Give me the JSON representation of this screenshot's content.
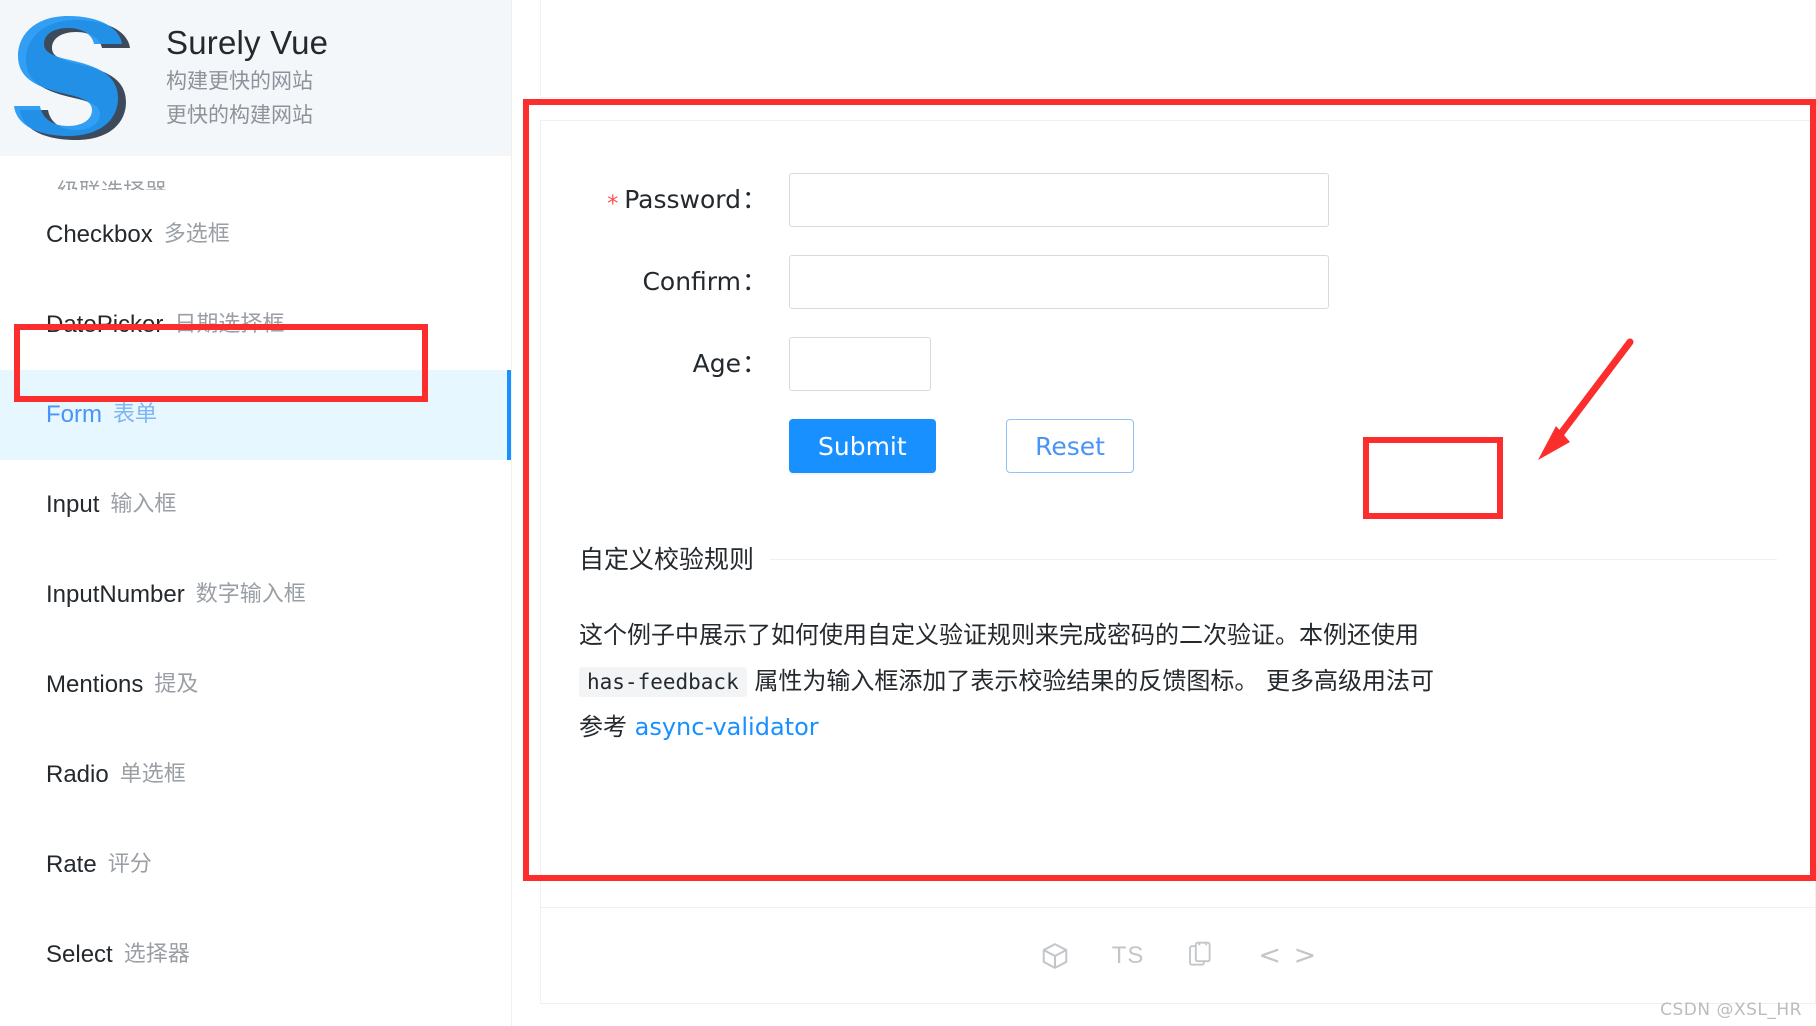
{
  "brand": {
    "title": "Surely Vue",
    "subtitle_line1": "构建更快的网站",
    "subtitle_line2": "更快的构建网站",
    "logo_letter": "S",
    "logo_colors": {
      "blue": "#1890ff",
      "dark": "#3c4a5c"
    },
    "background": "#f4f7fa"
  },
  "sidebar": {
    "items": [
      {
        "en": "",
        "cn": "级联选择器",
        "active": false,
        "clipped": true
      },
      {
        "en": "Checkbox",
        "cn": "多选框",
        "active": false
      },
      {
        "en": "DatePicker",
        "cn": "日期选择框",
        "active": false
      },
      {
        "en": "Form",
        "cn": "表单",
        "active": true
      },
      {
        "en": "Input",
        "cn": "输入框",
        "active": false
      },
      {
        "en": "InputNumber",
        "cn": "数字输入框",
        "active": false
      },
      {
        "en": "Mentions",
        "cn": "提及",
        "active": false
      },
      {
        "en": "Radio",
        "cn": "单选框",
        "active": false
      },
      {
        "en": "Rate",
        "cn": "评分",
        "active": false
      },
      {
        "en": "Select",
        "cn": "选择器",
        "active": false
      }
    ]
  },
  "toolbar": {
    "icons": [
      {
        "name": "codesandbox-icon",
        "label": ""
      },
      {
        "name": "typescript-icon",
        "label": "TS"
      },
      {
        "name": "copy-icon",
        "label": ""
      },
      {
        "name": "code-brackets-icon",
        "label": "< >"
      }
    ]
  },
  "form": {
    "fields": [
      {
        "label": "Password",
        "required": true,
        "value": "",
        "placeholder": "",
        "width": "wide"
      },
      {
        "label": "Confirm",
        "required": false,
        "value": "",
        "placeholder": "",
        "width": "wide"
      },
      {
        "label": "Age",
        "required": false,
        "value": "",
        "placeholder": "",
        "width": "narrow"
      }
    ],
    "colon": "：",
    "required_marker": "*",
    "submit_label": "Submit",
    "reset_label": "Reset"
  },
  "description": {
    "title": "自定义校验规则",
    "part1": "这个例子中展示了如何使用自定义验证规则来完成密码的二次验证。本例还使用",
    "code1": "has-feedback",
    "part2": "属性为输入框添加了表示校验结果的反馈图标。",
    "part3": "更多高级用法可参考",
    "link": "async-validator"
  },
  "annotations": {
    "color": "#fc2d2d",
    "boxes": [
      "sidebar-form-item",
      "main-demo-panel",
      "reset-button"
    ],
    "arrow": "points-to-reset-button"
  },
  "watermark": "CSDN @XSL_HR"
}
